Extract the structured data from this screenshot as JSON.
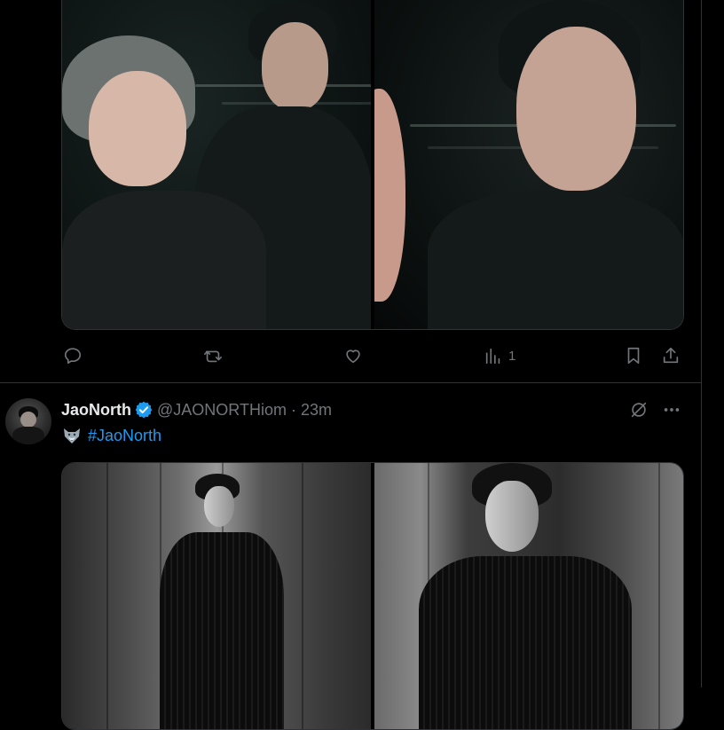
{
  "post1": {
    "stats": {
      "views": "1"
    }
  },
  "post2": {
    "author_name": "JaoNorth",
    "handle": "@JAONORTHiom",
    "separator": "·",
    "time": "23m",
    "hashtag": "#JaoNorth",
    "emoji": "wolf-emoji"
  },
  "colors": {
    "background": "#000000",
    "divider": "#2f3336",
    "muted": "#71767b",
    "accent": "#1d9bf0",
    "text": "#e7e9ea"
  }
}
